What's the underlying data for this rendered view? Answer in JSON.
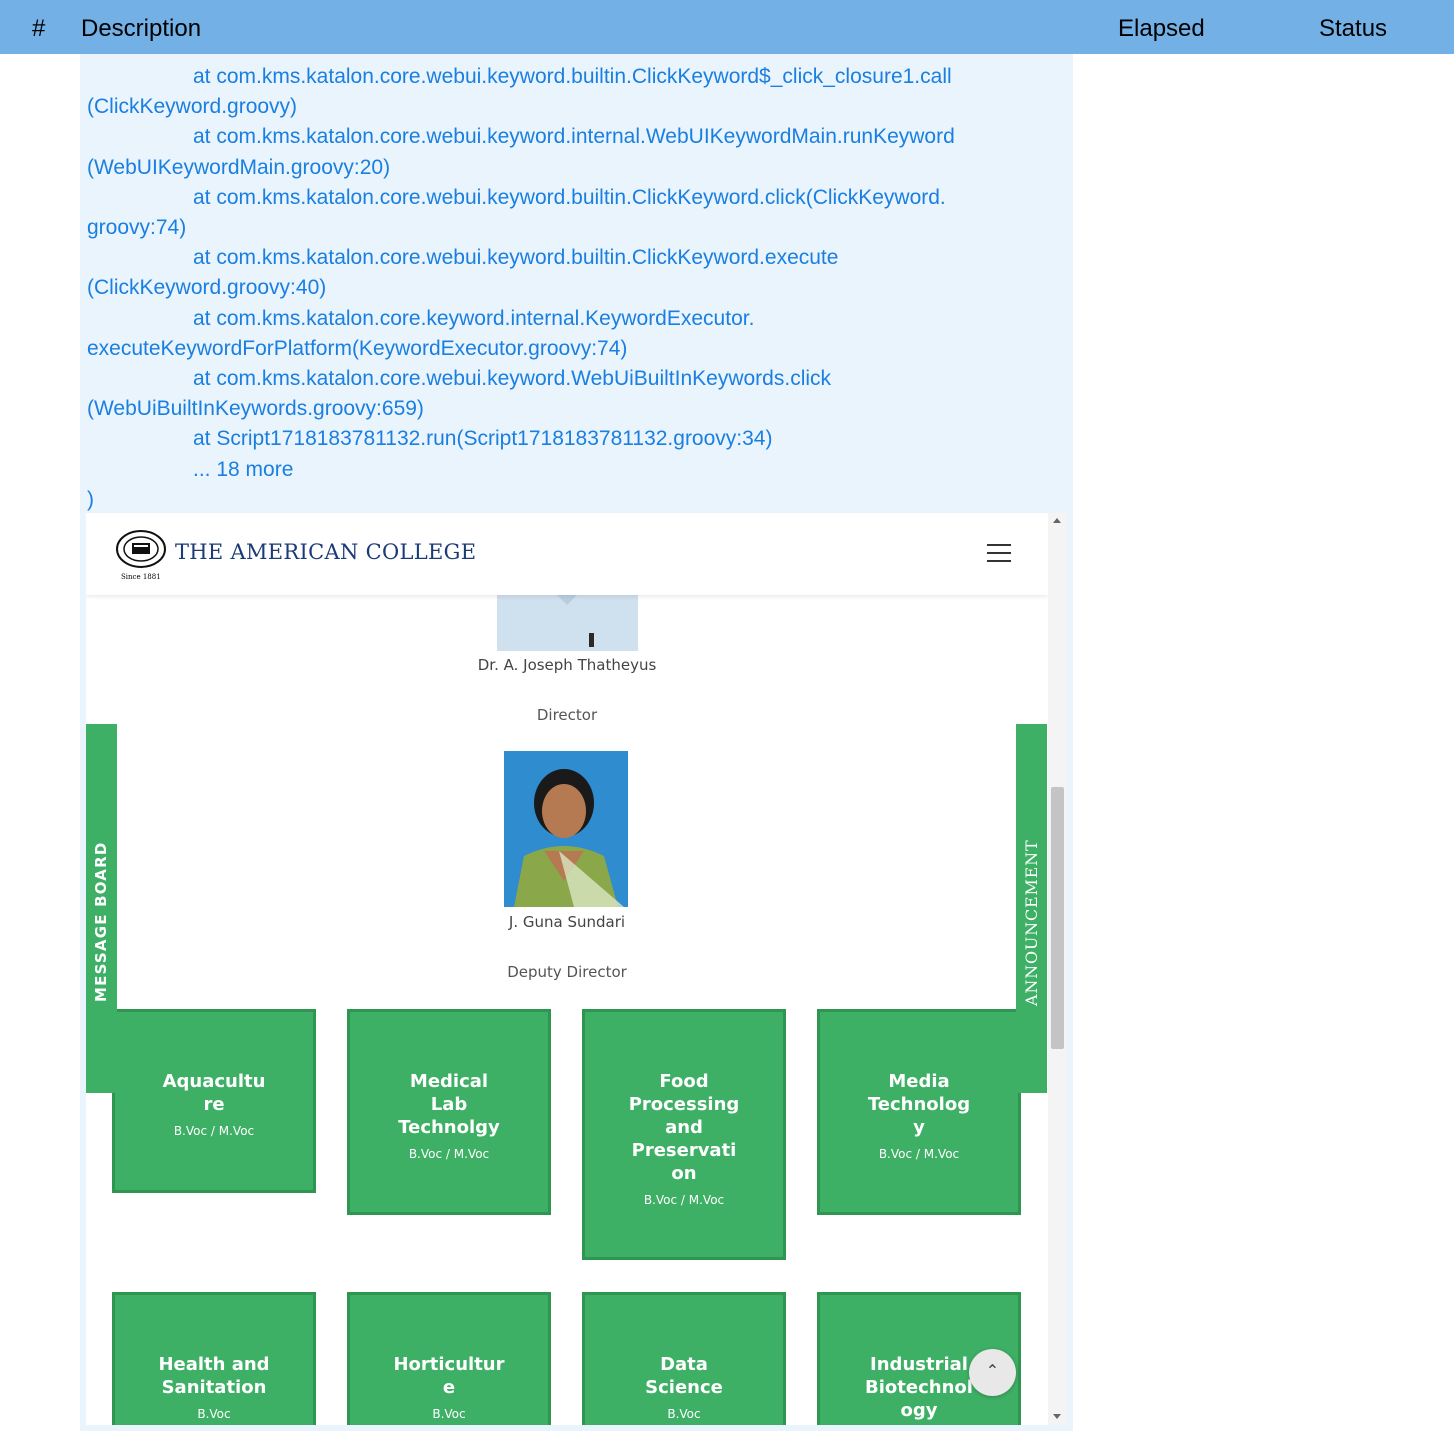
{
  "report_header": {
    "hash": "#",
    "description": "Description",
    "elapsed": "Elapsed",
    "status": "Status"
  },
  "log": {
    "lines": [
      "at com.kms.katalon.core.webui.keyword.builtin.ClickKeyword$_click_closure1.call",
      "(ClickKeyword.groovy)",
      "at com.kms.katalon.core.webui.keyword.internal.WebUIKeywordMain.runKeyword",
      "(WebUIKeywordMain.groovy:20)",
      "at com.kms.katalon.core.webui.keyword.builtin.ClickKeyword.click(ClickKeyword.",
      "groovy:74)",
      "at com.kms.katalon.core.webui.keyword.builtin.ClickKeyword.execute",
      "(ClickKeyword.groovy:40)",
      "at com.kms.katalon.core.keyword.internal.KeywordExecutor.",
      "executeKeywordForPlatform(KeywordExecutor.groovy:74)",
      "at com.kms.katalon.core.webui.keyword.WebUiBuiltInKeywords.click",
      "(WebUiBuiltInKeywords.groovy:659)",
      "at Script1718183781132.run(Script1718183781132.groovy:34)",
      "... 18 more",
      ")"
    ]
  },
  "site": {
    "logo_text": "THE AMERICAN COLLEGE",
    "logo_since": "Since 1881",
    "people": [
      {
        "name": "Dr. A. Joseph Thatheyus",
        "role": "Director"
      },
      {
        "name": "J. Guna Sundari",
        "role": "Deputy Director"
      }
    ],
    "side_tabs": {
      "left": "MESSAGE BOARD",
      "right": "ANNOUNCEMENT"
    },
    "courses": [
      {
        "title": "Aquaculture",
        "sub": "B.Voc / M.Voc"
      },
      {
        "title": "Medical Lab Technolgy",
        "sub": "B.Voc / M.Voc"
      },
      {
        "title": "Food Processing and Preservation",
        "sub": "B.Voc / M.Voc"
      },
      {
        "title": "Media Technology",
        "sub": "B.Voc / M.Voc"
      },
      {
        "title": "Health and Sanitation",
        "sub": "B.Voc"
      },
      {
        "title": "Horticulture",
        "sub": "B.Voc"
      },
      {
        "title": "Data Science",
        "sub": "B.Voc"
      },
      {
        "title": "Industrial Biotechnology",
        "sub": ""
      }
    ]
  },
  "colors": {
    "header_bg": "#72b0e5",
    "log_bg": "#eaf4fd",
    "log_text": "#1a7fe0",
    "brand_green": "#3eb065",
    "logo_blue": "#1c3a78"
  },
  "icons": {
    "menu": "hamburger-icon",
    "back_to_top": "chevron-up-icon"
  }
}
